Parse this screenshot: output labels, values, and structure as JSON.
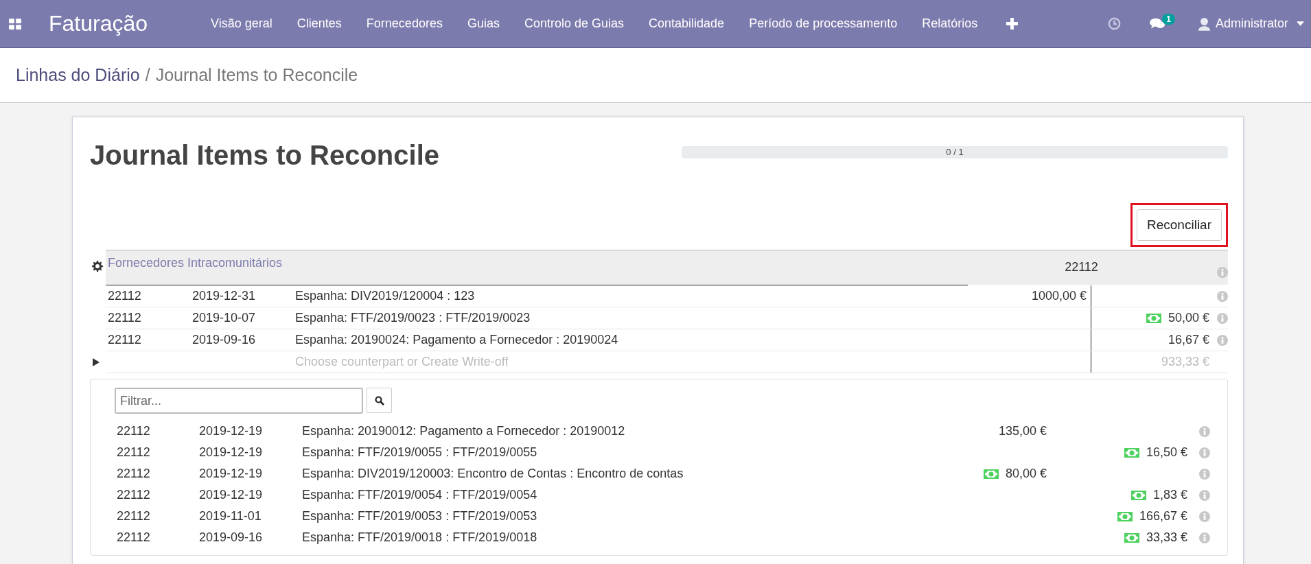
{
  "navbar": {
    "app_title": "Faturação",
    "menu": [
      "Visão geral",
      "Clientes",
      "Fornecedores",
      "Guias",
      "Controlo de Guias",
      "Contabilidade",
      "Período de processamento",
      "Relatórios"
    ],
    "messages_badge": "1",
    "user": "Administrator"
  },
  "breadcrumb": {
    "parent": "Linhas do Diário",
    "separator": "/",
    "current": "Journal Items to Reconcile"
  },
  "title": "Journal Items to Reconcile",
  "progress": {
    "label": "0 / 1",
    "level": 0
  },
  "reconcile_button": {
    "label": "Reconciliar",
    "highlighted": true
  },
  "account": {
    "name": "Fornecedores Intracomunitários",
    "code": "22112"
  },
  "lines": [
    {
      "account": "22112",
      "date": "2019-12-31",
      "label": "Espanha: DIV2019/120004 : 123",
      "debit": {
        "amount": "1000,00 €",
        "cash": false
      }
    },
    {
      "account": "22112",
      "date": "2019-10-07",
      "label": "Espanha: FTF/2019/0023 : FTF/2019/0023",
      "credit": {
        "amount": "50,00 €",
        "cash": true
      }
    },
    {
      "account": "22112",
      "date": "2019-09-16",
      "label": "Espanha: 20190024: Pagamento a Fornecedor : 20190024",
      "credit": {
        "amount": "16,67 €",
        "cash": false
      }
    }
  ],
  "remaining": {
    "placeholder": "Choose counterpart or Create Write-off",
    "amount": "933,33 €"
  },
  "filter": {
    "placeholder": "Filtrar..."
  },
  "candidates": [
    {
      "account": "22112",
      "date": "2019-12-19",
      "label": "Espanha: 20190012: Pagamento a Fornecedor : 20190012",
      "debit": {
        "amount": "135,00 €",
        "cash": false
      }
    },
    {
      "account": "22112",
      "date": "2019-12-19",
      "label": "Espanha: FTF/2019/0055 : FTF/2019/0055",
      "credit": {
        "amount": "16,50 €",
        "cash": true
      }
    },
    {
      "account": "22112",
      "date": "2019-12-19",
      "label": "Espanha: DIV2019/120003: Encontro de Contas : Encontro de contas",
      "debit": {
        "amount": "80,00 €",
        "cash": true
      }
    },
    {
      "account": "22112",
      "date": "2019-12-19",
      "label": "Espanha: FTF/2019/0054 : FTF/2019/0054",
      "credit": {
        "amount": "1,83 €",
        "cash": true
      }
    },
    {
      "account": "22112",
      "date": "2019-11-01",
      "label": "Espanha: FTF/2019/0053 : FTF/2019/0053",
      "credit": {
        "amount": "166,67 €",
        "cash": true
      }
    },
    {
      "account": "22112",
      "date": "2019-09-16",
      "label": "Espanha: FTF/2019/0018 : FTF/2019/0018",
      "credit": {
        "amount": "33,33 €",
        "cash": true
      }
    }
  ]
}
